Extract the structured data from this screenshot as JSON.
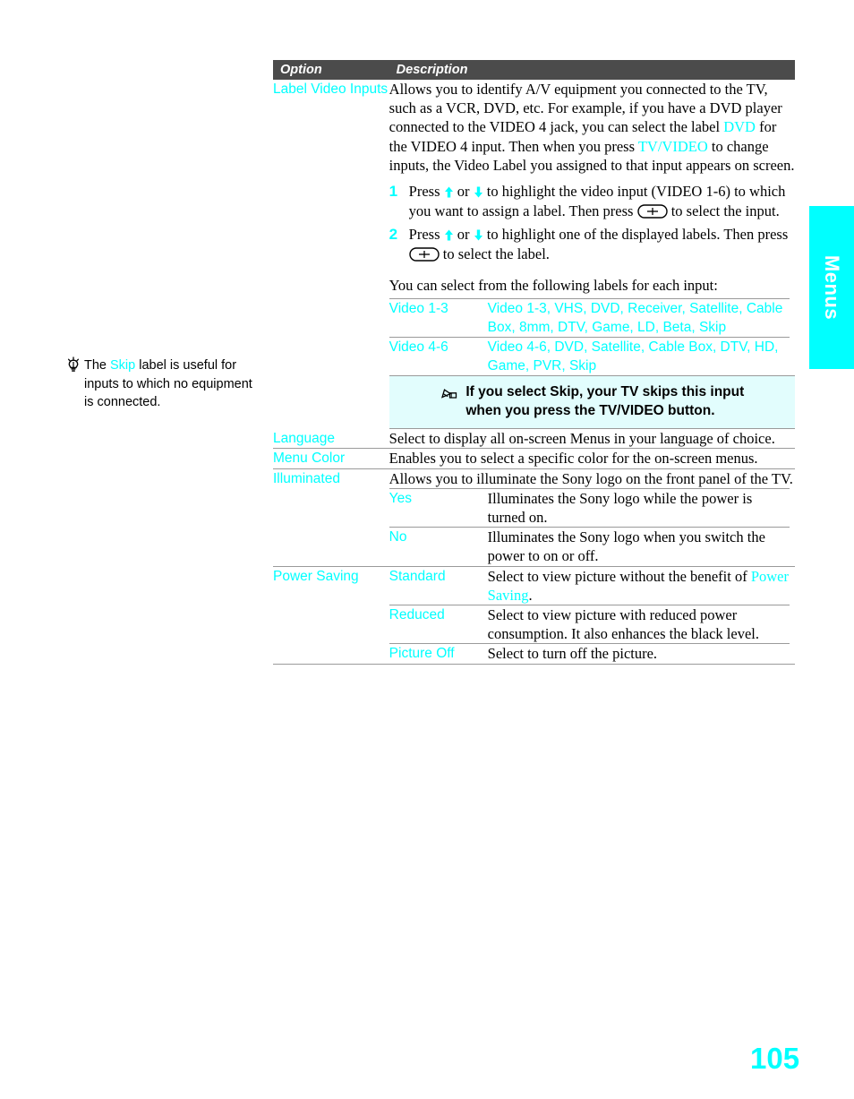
{
  "page": {
    "number": "105",
    "side_tab_label": "Menus",
    "accent_color": "#00ffff",
    "header_bg_color": "#4b4b4b",
    "note_bg_color": "#e2fdfd",
    "rule_color": "#9a9a9a"
  },
  "margin_tip": {
    "icon": "lightbulb-icon",
    "text_before": "The ",
    "highlight": "Skip",
    "text_after": " label is useful for inputs to which no equipment is connected."
  },
  "table": {
    "headers": {
      "option": "Option",
      "description": "Description"
    },
    "label_video_inputs": {
      "option": "Label Video Inputs",
      "paragraph_1a": "Allows you to identify A/V equipment you connected to the TV, such as a VCR, DVD, etc. For example, if you have a DVD player connected to the VIDEO 4 jack, you can select the label ",
      "paragraph_1_hl1": "DVD",
      "paragraph_1b": " for the VIDEO 4 input. Then when you press ",
      "paragraph_1_hl2": "TV/VIDEO",
      "paragraph_1c": " to change inputs, the Video Label you assigned to that input appears on screen.",
      "steps": [
        {
          "number": "1",
          "text_a": "Press ",
          "icon_up": "arrow-up-icon",
          "text_b": " or ",
          "icon_down": "arrow-down-icon",
          "text_c": " to highlight the video input (VIDEO 1-6) to which you want to assign a label. Then press ",
          "icon_select": "select-button-icon",
          "text_d": " to select the input."
        },
        {
          "number": "2",
          "text_a": "Press ",
          "icon_up": "arrow-up-icon",
          "text_b": " or ",
          "icon_down": "arrow-down-icon",
          "text_c": " to highlight one of the displayed labels. Then press ",
          "icon_select": "select-button-icon",
          "text_d": " to select the label."
        }
      ],
      "intro_line": "You can select from the following labels for each input:",
      "label_rows": [
        {
          "name": "Video 1-3",
          "values": "Video 1-3, VHS, DVD, Receiver, Satellite, Cable Box, 8mm, DTV, Game, LD, Beta, Skip"
        },
        {
          "name": "Video 4-6",
          "values": "Video 4-6, DVD, Satellite, Cable Box, DTV, HD, Game, PVR, Skip"
        }
      ],
      "note": {
        "icon": "pencil-note-icon",
        "line_1": "If you select Skip, your TV skips this input",
        "line_2": "when you press the TV/VIDEO button."
      }
    },
    "rows": [
      {
        "option": "Language",
        "description": "Select to display all on-screen Menus in your language of choice."
      },
      {
        "option": "Menu Color",
        "description": "Enables you to select a specific color for the on-screen menus."
      },
      {
        "option": "Illuminated",
        "description": "Allows you to illuminate the Sony logo on the front panel of the TV.",
        "sub_rows": [
          {
            "name": "Yes",
            "description": "Illuminates the Sony logo while the power is turned on."
          },
          {
            "name": "No",
            "description": "Illuminates the Sony logo when you switch the power to on or off."
          }
        ]
      },
      {
        "option": "Power Saving",
        "description": "",
        "sub_rows": [
          {
            "name": "Standard",
            "description_a": "Select to view picture without the benefit of ",
            "description_hl": "Power Saving",
            "description_b": "."
          },
          {
            "name": "Reduced",
            "description": "Select to view picture with reduced power consumption. It also enhances the black level."
          },
          {
            "name": "Picture Off",
            "description": "Select to turn off the picture."
          }
        ]
      }
    ]
  }
}
